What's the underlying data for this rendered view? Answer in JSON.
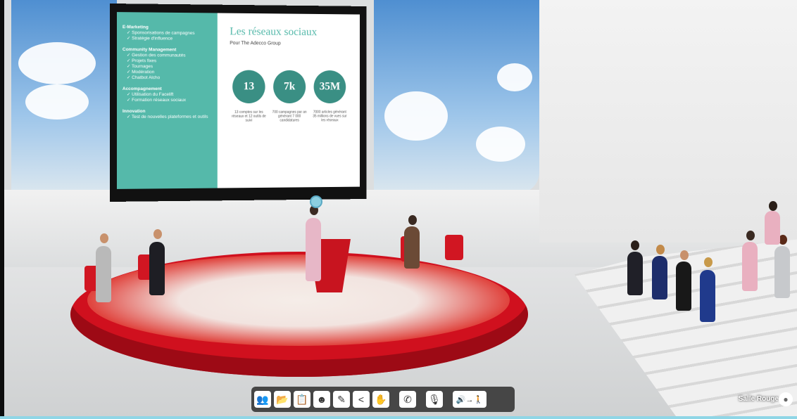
{
  "slide": {
    "left_sections": [
      {
        "title": "E-Marketing",
        "items": [
          "Sponsorisations de campagnes",
          "Stratégie d'influence"
        ]
      },
      {
        "title": "Community Management",
        "items": [
          "Gestion des communautés",
          "Projets fixes",
          "Tournages",
          "Modération",
          "Chatbot Alcho"
        ]
      },
      {
        "title": "Accompagnement",
        "items": [
          "Utilisation du Facelift",
          "Formation réseaux sociaux"
        ]
      },
      {
        "title": "Innovation",
        "items": [
          "Test de nouvelles plateformes et outils"
        ]
      }
    ],
    "title": "Les réseaux sociaux",
    "subtitle": "Pour The Adecco Group",
    "stats": [
      {
        "value": "13",
        "caption": "13 comptes sur les réseaux et 12 outils de suivi"
      },
      {
        "value": "7k",
        "caption": "700 campagnes par an générant 7 000 candidatures"
      },
      {
        "value": "35M",
        "caption": "7000 articles générant 35 millions de vues sur les réseaux"
      }
    ]
  },
  "toolbar": {
    "buttons": [
      {
        "icon": "user-question-icon",
        "glyph": "👥"
      },
      {
        "icon": "folder-icon",
        "glyph": "📂"
      },
      {
        "icon": "clipboard-icon",
        "glyph": "📋"
      },
      {
        "icon": "emoji-icon",
        "glyph": "☻"
      },
      {
        "icon": "edit-icon",
        "glyph": "✎"
      },
      {
        "icon": "share-icon",
        "glyph": "<"
      },
      {
        "icon": "raise-hand-icon",
        "glyph": "✋"
      },
      {
        "icon": "phone-icon",
        "glyph": "✆"
      },
      {
        "icon": "microphone-icon",
        "glyph": "🎙"
      },
      {
        "icon": "audio-exit-icon",
        "glyph": "🔊→🚶"
      }
    ]
  },
  "location": {
    "room_name": "Salle Rouge",
    "icon": "location-pin-icon"
  }
}
